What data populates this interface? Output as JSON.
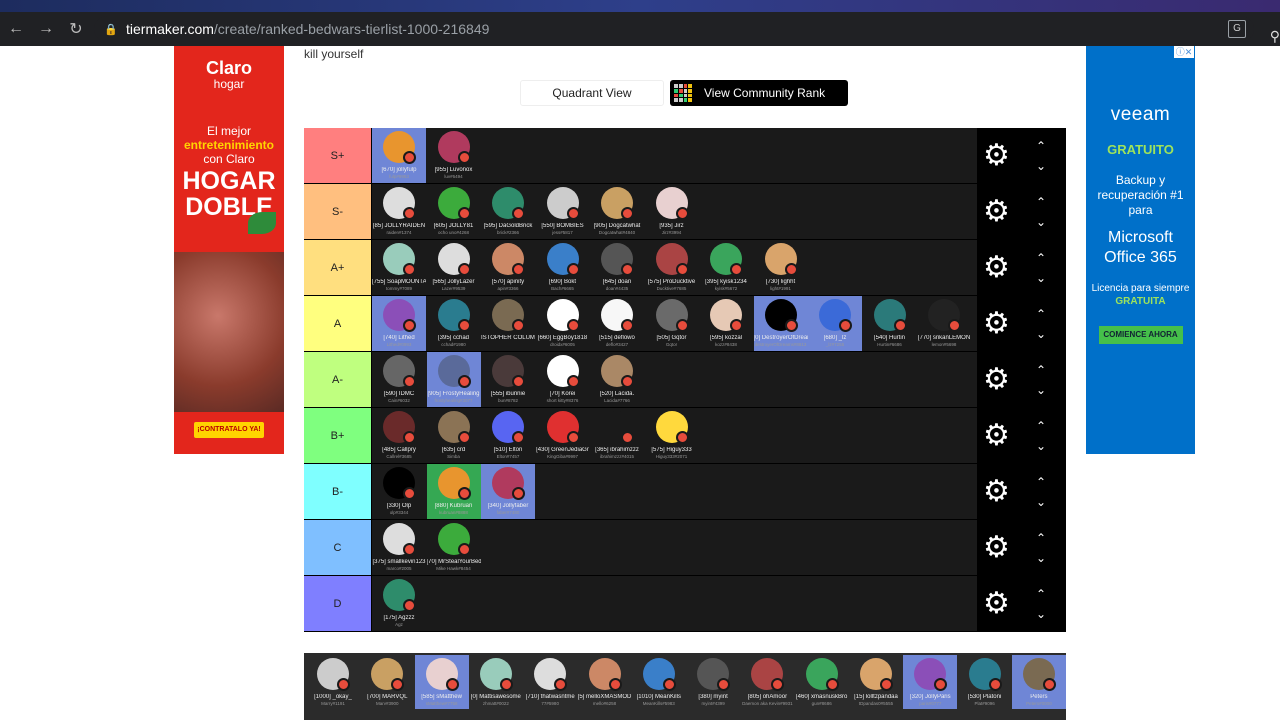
{
  "browser": {
    "host": "tiermaker.com",
    "path": "/create/ranked-bedwars-tierlist-1000-216849"
  },
  "caption": "kill yourself",
  "view_buttons": {
    "quadrant": "Quadrant View",
    "community": "View Community Rank"
  },
  "ads": {
    "left": {
      "brand": "Claro",
      "brand_sub": "hogar",
      "l1": "El mejor",
      "l2": "entretenimiento",
      "l3": "con Claro",
      "l4": "HOGAR DOBLE",
      "cta": "¡CONTRATALO YA!"
    },
    "right": {
      "brand": "veeam",
      "gratis": "GRATUITO",
      "body": "Backup y recuperación #1 para",
      "office": "Microsoft Office 365",
      "license_a": "Licencia para siempre",
      "license_b": "GRATUITA",
      "cta": "COMIENCE AHORA"
    }
  },
  "tiers": [
    {
      "label": "S+",
      "color": "#ff7f7f",
      "items": [
        {
          "name": "[670] jollyfulp",
          "tag": "fulp#9953",
          "hl": 1
        },
        {
          "name": "[955] Luvonox",
          "tag": "luv#6494"
        }
      ]
    },
    {
      "label": "S-",
      "color": "#ffbf7f",
      "items": [
        {
          "name": "[85] JOLLYRAIDEN",
          "tag": "raiden#1374"
        },
        {
          "name": "[605] JOLLY81",
          "tag": "ocho uno#4268"
        },
        {
          "name": "[595] DaGoldBrick",
          "tag": "brick#2366"
        },
        {
          "name": "[550] BOMBIES",
          "tag": "jess#5817"
        },
        {
          "name": "[905] Dogcatwhat",
          "tag": "Dogcatwhat#4840"
        },
        {
          "name": "[935] Jirz",
          "tag": "Jirz#3994"
        }
      ]
    },
    {
      "label": "A+",
      "color": "#ffdf7f",
      "items": [
        {
          "name": "[755] SoapMOUNTAIN",
          "tag": "tommy#7089"
        },
        {
          "name": "[565] JollyLazer",
          "tag": "Lazer#9539"
        },
        {
          "name": "[570] apinity",
          "tag": "apin#3366"
        },
        {
          "name": "[690] Bokt",
          "tag": "Bach#6665"
        },
        {
          "name": "[645] doan",
          "tag": "doan#4435"
        },
        {
          "name": "[575] ProDucktive",
          "tag": "Ducktive#7685"
        },
        {
          "name": "[395] kyisk1234",
          "tag": "kyisk#5672"
        },
        {
          "name": "[730] lighht",
          "tag": "light#1991"
        }
      ]
    },
    {
      "label": "A",
      "color": "#ffff7f",
      "items": [
        {
          "name": "[740] Lithed",
          "tag": "Lithed#0993",
          "hl": 1
        },
        {
          "name": "[395] cchad",
          "tag": "cchad#1980"
        },
        {
          "name": "ISTOPHER COLUMI",
          "tag": ""
        },
        {
          "name": "[660] EggBoy1818",
          "tag": "droidx#6005"
        },
        {
          "name": "[515] deflowo",
          "tag": "deflo#3427"
        },
        {
          "name": "[505] Gqtor",
          "tag": "Gqtor"
        },
        {
          "name": "[595] kozzal",
          "tag": "kozz#8438"
        },
        {
          "name": "[0] DestroyerOfDream",
          "tag": "destroyerOfDreams#8813",
          "hl": 1
        },
        {
          "name": "[680] _lz",
          "tag": "_lz#7255",
          "hl": 1
        },
        {
          "name": "[540] Hurtin",
          "tag": "Hurtin#6686"
        },
        {
          "name": "[770] srikanLEMON",
          "tag": "lemon#5698"
        }
      ]
    },
    {
      "label": "A-",
      "color": "#bfff7f",
      "items": [
        {
          "name": "[590] IDMC",
          "tag": "Cain#6032"
        },
        {
          "name": "[905] FrostyHealing",
          "tag": "frostyhealing#3077",
          "hl": 1
        },
        {
          "name": "[555] ibunnie",
          "tag": "bun#8782"
        },
        {
          "name": "[70] Korei",
          "tag": "short kitty#8376"
        },
        {
          "name": "[520] Lacida.",
          "tag": "Lacida#7766"
        }
      ]
    },
    {
      "label": "B+",
      "color": "#7fff7f",
      "items": [
        {
          "name": "[485] Callpry",
          "tag": "Callrel#3685"
        },
        {
          "name": "[635] crd",
          "tag": "Simba"
        },
        {
          "name": "[510] Elton",
          "tag": "Elton#7457"
        },
        {
          "name": "[430] GreenJediaGr",
          "tag": "KingGiba#9997"
        },
        {
          "name": "[365] ibrahimzzz",
          "tag": "ibrahimzzz#4015"
        },
        {
          "name": "[575] Higuy333",
          "tag": "Higuy333#2071"
        }
      ]
    },
    {
      "label": "B-",
      "color": "#7fffff",
      "items": [
        {
          "name": "[330] Olp",
          "tag": "olp#3344"
        },
        {
          "name": "[880] Kubruan",
          "tag": "kubruan#8888",
          "hlg": 1
        },
        {
          "name": "[340] Jollyfaber",
          "tag": "faber#7480",
          "hl": 1
        }
      ]
    },
    {
      "label": "C",
      "color": "#7fbfff",
      "items": [
        {
          "name": "[375] smallkevin123",
          "tag": "marco#2005"
        },
        {
          "name": "[70] MrStealYourBed",
          "tag": "Mike Hawk#8454"
        }
      ]
    },
    {
      "label": "D",
      "color": "#7f7fff",
      "items": [
        {
          "name": "[175] Agzzz",
          "tag": "Agz"
        }
      ]
    }
  ],
  "pool": [
    {
      "name": "[1000] _okay_",
      "tag": "Marry#1191"
    },
    {
      "name": "[700] MARVQL",
      "tag": "Marv#3900"
    },
    {
      "name": "[585] sMatthew",
      "tag": "sMatthew#7758",
      "hl": 1
    },
    {
      "name": "[0] Mattisawesome",
      "tag": "zhmatt#0022"
    },
    {
      "name": "[710] thatwasntme",
      "tag": "77#5980"
    },
    {
      "name": "[5] melloXMASMOD",
      "tag": "mello#6258"
    },
    {
      "name": "[1010] MeanKills",
      "tag": "MeanKills#5983"
    },
    {
      "name": "[380] myint",
      "tag": "myint#4399"
    },
    {
      "name": "[805] ohAmoor",
      "tag": "Daemon aka Kevin#9931"
    },
    {
      "name": "[460] xmasnuskBro",
      "tag": "gun#8686"
    },
    {
      "name": "[15] lolltzpandaa",
      "tag": "tDpandas0#5555"
    },
    {
      "name": "[320] JollyParis",
      "tag": "paris#0777",
      "hl": 1
    },
    {
      "name": "[530] Platoni",
      "tag": "Plat#9096"
    },
    {
      "name": "Peters",
      "tag": "Peters#0000",
      "hl": 1
    }
  ],
  "avatar_colors": [
    "#e8952e",
    "#b03a5e",
    "#ddd",
    "#3cab3c",
    "#2e8c6b",
    "#ccc",
    "#c9a063",
    "#e8d0d0",
    "#9cb",
    "#ddd",
    "#c86",
    "#3a7fc9",
    "#555",
    "#a44",
    "#3aa55c",
    "#d9a46b",
    "#8b4fb8",
    "#2a7c8f",
    "#7a6a52",
    "#fff",
    "#f7f7f7",
    "#6a6a6a",
    "#e6c9b5",
    "#000",
    "#3b6ad8",
    "#2b7a7a",
    "#222",
    "#666",
    "#5a6a9a",
    "#4a3a3a",
    "#ffffff",
    "#a86",
    "#6a2a2a",
    "#8b7355",
    "#5865f2",
    "#e03030",
    "#1a1a1a",
    "#ffd93d",
    "#000000"
  ]
}
